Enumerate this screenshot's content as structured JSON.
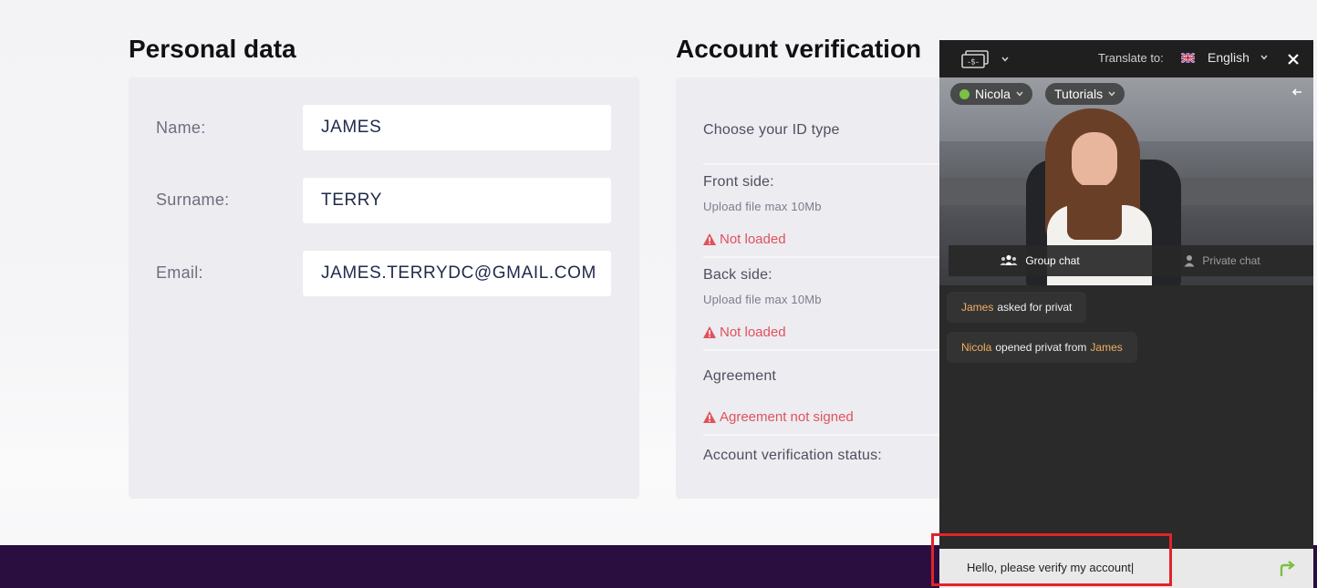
{
  "personal": {
    "title": "Personal data",
    "name_label": "Name:",
    "name_value": "JAMES",
    "surname_label": "Surname:",
    "surname_value": "TERRY",
    "email_label": "Email:",
    "email_value": "JAMES.TERRYDC@GMAIL.COM"
  },
  "verification": {
    "title": "Account verification",
    "id_type_label": "Choose your ID type",
    "front_label": "Front side:",
    "front_hint": "Upload file max 10Mb",
    "front_status": "Not loaded",
    "back_label": "Back side:",
    "back_hint": "Upload file max 10Mb",
    "back_status": "Not loaded",
    "agreement_label": "Agreement",
    "agreement_status": "Agreement not signed",
    "status_label": "Account verification status:"
  },
  "chat": {
    "translate_label": "Translate to:",
    "language": "English",
    "model_name": "Nicola",
    "tutorials_label": "Tutorials",
    "tabs": {
      "group": "Group chat",
      "private": "Private chat"
    },
    "messages": [
      {
        "nick": "James",
        "text": "asked for privat"
      },
      {
        "nick": "Nicola",
        "text": "opened privat from",
        "nick2": "James"
      }
    ],
    "input_value": "Hello, please verify my account|",
    "icons": {
      "tip": "money-icon",
      "close": "close-icon",
      "send": "send-arrow-icon",
      "online": "online-status-dot",
      "group": "group-users-icon",
      "private": "user-icon",
      "collapse": "collapse-arrow-icon",
      "flag": "uk-flag-icon"
    },
    "colors": {
      "accent_green": "#7bc043",
      "nick_orange": "#f0b060",
      "warning_red": "#e0525c",
      "footer_purple": "#2a0e3f"
    }
  }
}
